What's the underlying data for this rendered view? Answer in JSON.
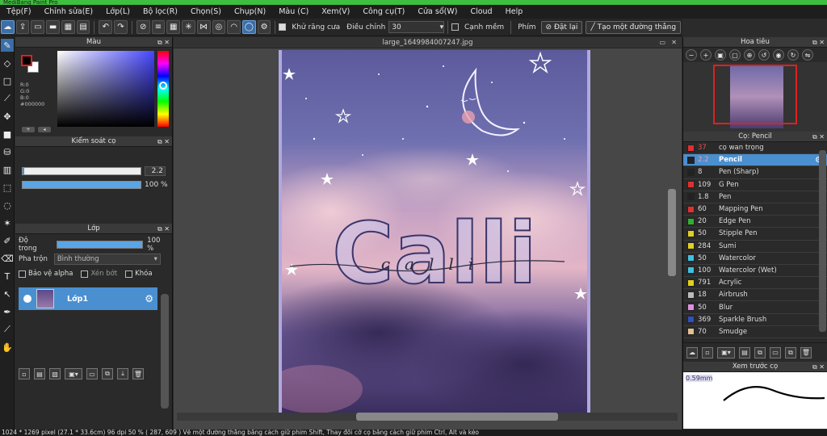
{
  "titlebar": {
    "text": "MediBang Paint Pro"
  },
  "menu": {
    "items": [
      "Tệp(F)",
      "Chỉnh sửa(E)",
      "Lớp(L)",
      "Bộ lọc(R)",
      "Chọn(S)",
      "Chụp(N)",
      "Màu (C)",
      "Xem(V)",
      "Công cụ(T)",
      "Cửa sổ(W)",
      "Cloud",
      "Help"
    ]
  },
  "toolbar": {
    "antialias_label": "Khử răng cưa",
    "adjust_label": "Điều chỉnh",
    "adjust_value": "30",
    "soft_edge_label": "Cạnh mềm",
    "key_label": "Phím",
    "reset_label": "Đặt lại",
    "straight_line_label": "Tạo một đường thẳng"
  },
  "color_panel": {
    "title": "Màu",
    "r": "R:0",
    "g": "G:0",
    "b": "B:0",
    "hex": "#000000",
    "fg_color": "#000000",
    "bg_color": "#ffffff"
  },
  "brush_control": {
    "title": "Kiểm soát cọ",
    "size_value": "2.2",
    "opacity_value": "100 %",
    "opacity_fraction": 1.0
  },
  "layer_panel": {
    "title": "Lớp",
    "opacity_label": "Độ trong",
    "opacity_value": "100 %",
    "blend_label": "Pha trộn",
    "blend_value": "Bình thường",
    "protect_alpha": "Bảo vệ alpha",
    "clipping": "Xén bớt",
    "lock": "Khóa",
    "layer_name": "Lớp1"
  },
  "document": {
    "tab": "large_1649984007247.jpg",
    "art_text": "Calli",
    "art_script_text": "calli"
  },
  "navigator": {
    "title": "Hoa tiêu"
  },
  "brush_list": {
    "title": "Cọ: Pencil",
    "items": [
      {
        "size": "37",
        "name": "cọ wan trọng",
        "color": "#e03030"
      },
      {
        "size": "2.2",
        "name": "Pencil",
        "color": "#222222"
      },
      {
        "size": "8",
        "name": "Pen (Sharp)",
        "color": "#222222"
      },
      {
        "size": "109",
        "name": "G Pen",
        "color": "#e03030"
      },
      {
        "size": "1.8",
        "name": "Pen",
        "color": "#222222"
      },
      {
        "size": "60",
        "name": "Mapping Pen",
        "color": "#e03030"
      },
      {
        "size": "20",
        "name": "Edge Pen",
        "color": "#30b030"
      },
      {
        "size": "50",
        "name": "Stipple Pen",
        "color": "#e0d020"
      },
      {
        "size": "284",
        "name": "Sumi",
        "color": "#e0d020"
      },
      {
        "size": "50",
        "name": "Watercolor",
        "color": "#40c0e0"
      },
      {
        "size": "100",
        "name": "Watercolor (Wet)",
        "color": "#40c0e0"
      },
      {
        "size": "791",
        "name": "Acrylic",
        "color": "#e0d020"
      },
      {
        "size": "18",
        "name": "Airbrush",
        "color": "#bbbbbb"
      },
      {
        "size": "50",
        "name": "Blur",
        "color": "#e090e0"
      },
      {
        "size": "369",
        "name": "Sparkle Brush",
        "color": "#3050c0"
      },
      {
        "size": "70",
        "name": "Smudge",
        "color": "#e0c090"
      }
    ]
  },
  "brush_preview": {
    "title": "Xem trước cọ",
    "size": "0.59mm"
  },
  "status": {
    "text": "1024 * 1269 pixel   (27.1 * 33.6cm)   96 dpi   50 %   ( 287, 609 )   Vẽ một đường thẳng bằng cách giữ phím Shift, Thay đổi cỡ cọ bằng cách giữ phím Ctrl, Alt và kéo"
  }
}
